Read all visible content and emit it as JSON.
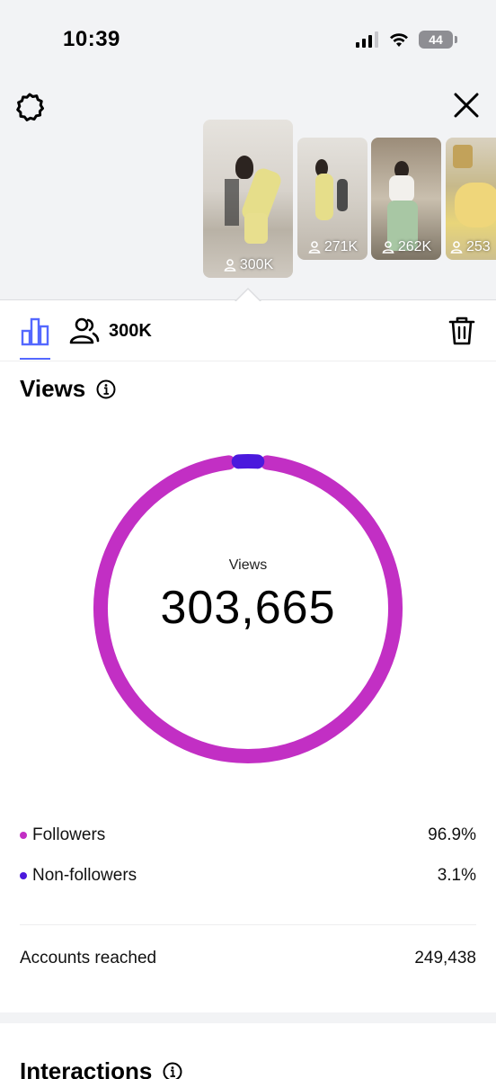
{
  "status_bar": {
    "time": "10:39",
    "battery": "44"
  },
  "reels": [
    {
      "views": "300K",
      "selected": true
    },
    {
      "views": "271K"
    },
    {
      "views": "262K"
    },
    {
      "views": "253"
    }
  ],
  "tabs": {
    "followers_count": "300K"
  },
  "views": {
    "title": "Views",
    "center_label": "Views",
    "total": "303,665",
    "followers": {
      "label": "Followers",
      "value": "96.9%"
    },
    "non_followers": {
      "label": "Non-followers",
      "value": "3.1%"
    },
    "accounts_reached": {
      "label": "Accounts reached",
      "value": "249,438"
    }
  },
  "interactions": {
    "title": "Interactions"
  },
  "colors": {
    "followers": "#c22fc4",
    "non_followers": "#4b19dd",
    "accent": "#5468ff"
  },
  "chart_data": {
    "type": "pie",
    "categories": [
      "Followers",
      "Non-followers"
    ],
    "values": [
      96.9,
      3.1
    ]
  }
}
